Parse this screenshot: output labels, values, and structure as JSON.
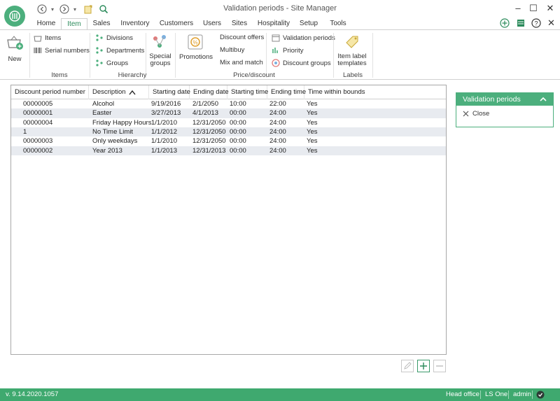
{
  "window": {
    "title": "Validation periods - Site Manager"
  },
  "tabs": [
    {
      "label": "Home"
    },
    {
      "label": "Item"
    },
    {
      "label": "Sales"
    },
    {
      "label": "Inventory"
    },
    {
      "label": "Customers"
    },
    {
      "label": "Users"
    },
    {
      "label": "Sites"
    },
    {
      "label": "Hospitality"
    },
    {
      "label": "Setup"
    },
    {
      "label": "Tools"
    }
  ],
  "ribbon": {
    "new_label": "New",
    "items_label": "Items",
    "serial_numbers_label": "Serial numbers",
    "divisions_label": "Divisions",
    "departments_label": "Departments",
    "groups_label": "Groups",
    "special_groups_label": "Special groups",
    "promotions_label": "Promotions",
    "discount_offers_label": "Discount offers",
    "multibuy_label": "Multibuy",
    "mix_and_match_label": "Mix and match",
    "validation_periods_label": "Validation periods",
    "priority_label": "Priority",
    "discount_groups_label": "Discount groups",
    "item_label_templates_label": "Item label templates",
    "group_items": "Items",
    "group_hierarchy": "Hierarchy",
    "group_price_discount": "Price/discount",
    "group_labels": "Labels"
  },
  "grid": {
    "columns": [
      "Discount period number",
      "Description",
      "Starting date",
      "Ending date",
      "Starting time",
      "Ending time",
      "Time within bounds"
    ],
    "rows": [
      [
        "00000005",
        "Alcohol",
        "9/19/2016",
        "2/1/2050",
        "10:00",
        "22:00",
        "Yes"
      ],
      [
        "00000001",
        "Easter",
        "3/27/2013",
        "4/1/2013",
        "00:00",
        "24:00",
        "Yes"
      ],
      [
        "00000004",
        "Friday Happy Hours",
        "1/1/2010",
        "12/31/2050",
        "00:00",
        "24:00",
        "Yes"
      ],
      [
        "1",
        "No Time Limit",
        "1/1/2012",
        "12/31/2050",
        "00:00",
        "24:00",
        "Yes"
      ],
      [
        "00000003",
        "Only weekdays",
        "1/1/2010",
        "12/31/2050",
        "00:00",
        "24:00",
        "Yes"
      ],
      [
        "00000002",
        "Year 2013",
        "1/1/2013",
        "12/31/2013",
        "00:00",
        "24:00",
        "Yes"
      ]
    ]
  },
  "side_panel": {
    "title": "Validation periods",
    "close_label": "Close"
  },
  "status": {
    "version": "v. 9.14.2020.1057",
    "site": "Head office",
    "product": "LS One",
    "user": "admin"
  },
  "colors": {
    "accent": "#4caf7d",
    "status_bar": "#3fa96f",
    "row_alt": "#e8ebf0"
  }
}
